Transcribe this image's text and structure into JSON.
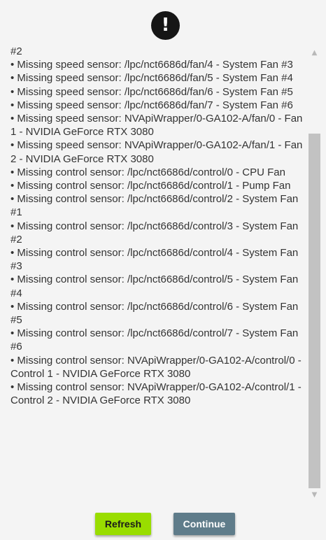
{
  "header": {
    "icon": "exclamation-icon",
    "icon_glyph": "!"
  },
  "log": {
    "lines": [
      "#2",
      "• Missing speed sensor: /lpc/nct6686d/fan/4 - System Fan #3",
      "• Missing speed sensor: /lpc/nct6686d/fan/5 - System Fan #4",
      "• Missing speed sensor: /lpc/nct6686d/fan/6 - System Fan #5",
      "• Missing speed sensor: /lpc/nct6686d/fan/7 - System Fan #6",
      "• Missing speed sensor: NVApiWrapper/0-GA102-A/fan/0 - Fan 1 - NVIDIA GeForce RTX 3080",
      "• Missing speed sensor: NVApiWrapper/0-GA102-A/fan/1 - Fan 2 - NVIDIA GeForce RTX 3080",
      "• Missing control sensor: /lpc/nct6686d/control/0 - CPU Fan",
      "• Missing control sensor: /lpc/nct6686d/control/1 - Pump Fan",
      "• Missing control sensor: /lpc/nct6686d/control/2 - System Fan #1",
      "• Missing control sensor: /lpc/nct6686d/control/3 - System Fan #2",
      "• Missing control sensor: /lpc/nct6686d/control/4 - System Fan #3",
      "• Missing control sensor: /lpc/nct6686d/control/5 - System Fan #4",
      "• Missing control sensor: /lpc/nct6686d/control/6 - System Fan #5",
      "• Missing control sensor: /lpc/nct6686d/control/7 - System Fan #6",
      "• Missing control sensor: NVApiWrapper/0-GA102-A/control/0 - Control 1 - NVIDIA GeForce RTX 3080",
      "• Missing control sensor: NVApiWrapper/0-GA102-A/control/1 - Control 2 - NVIDIA GeForce RTX 3080"
    ]
  },
  "scrollbar": {
    "up_glyph": "▲",
    "down_glyph": "▼"
  },
  "buttons": {
    "refresh_label": "Refresh",
    "continue_label": "Continue"
  },
  "colors": {
    "refresh": "#99dd00",
    "continue": "#5f7c8a",
    "icon_bg": "#161616"
  }
}
